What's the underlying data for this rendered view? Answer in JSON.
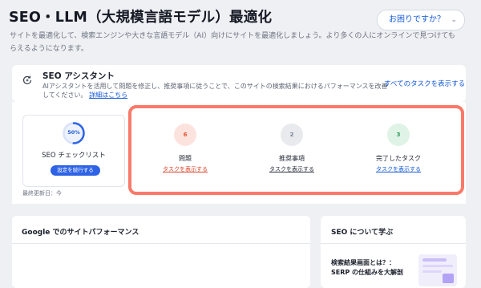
{
  "header": {
    "title": "SEO・LLM（大規模言語モデル）最適化",
    "subtitle": "サイトを最適化して、検索エンジンや大きな言語モデル（AI）向けにサイトを最適化しましょう。より多くの人にオンラインで見つけてもらえるようになります。",
    "help_button": "お困りですか？",
    "help_icon": "chevron-down-icon"
  },
  "assistant": {
    "title": "SEO アシスタント",
    "description": "AIアシスタントを活用して問題を修正し、推奨事項に従うことで、このサイトの検索結果におけるパフォーマンスを改善してください。",
    "details_link": "詳細はこちら",
    "view_all": "すべてのタスクを表示する",
    "icon": "sparkle-refresh-icon"
  },
  "checklist": {
    "progress_percent": 50,
    "progress_label": "50%",
    "label": "SEO チェックリスト",
    "continue_button": "設定を続行する",
    "last_updated": "最終更新日：今"
  },
  "stats": [
    {
      "count": "6",
      "label": "問題",
      "link": "タスクを表示する",
      "color": "#e45232"
    },
    {
      "count": "2",
      "label": "推奨事項",
      "link": "タスクを表示する",
      "color": "#7b8291"
    },
    {
      "count": "3",
      "label": "完了したタスク",
      "link": "タスクを表示する",
      "color": "#2e9b59"
    }
  ],
  "performance": {
    "title": "Google でのサイトパフォーマンス"
  },
  "learn": {
    "title": "SEO について学ぶ",
    "article_title": "検索結果画面とは？：SERP の仕組みを大解剖"
  },
  "colors": {
    "accent": "#2e63e6",
    "highlight": "#fa7a6a",
    "link": "#1358d6"
  }
}
